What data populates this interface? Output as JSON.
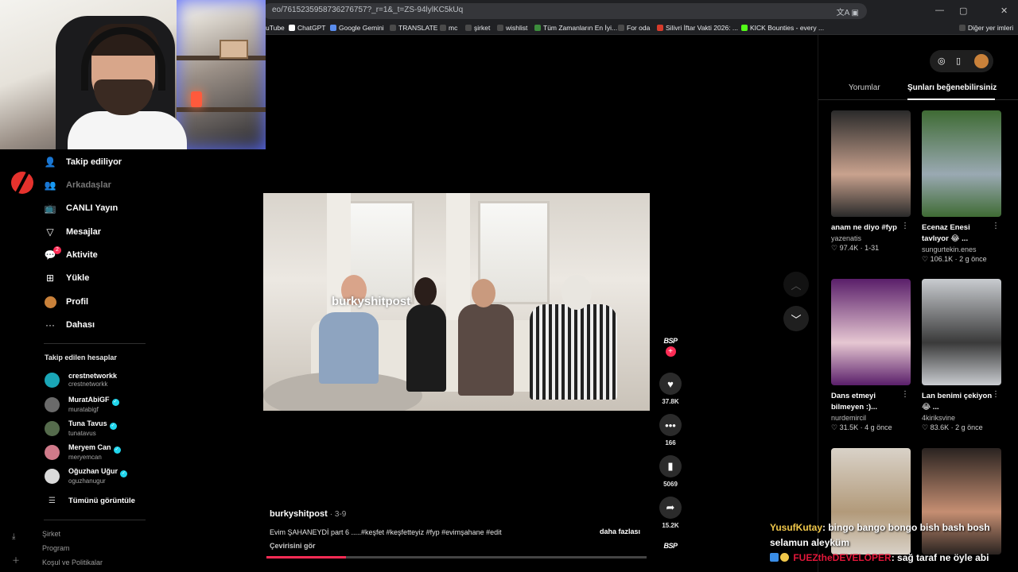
{
  "browser": {
    "url": "eo/7615235958736276757?_r=1&_t=ZS-94lylKC5kUq",
    "bookmarks": [
      "uTube",
      "ChatGPT",
      "Google Gemini",
      "TRANSLATE",
      "mc",
      "şirket",
      "wishlist",
      "Tüm Zamanların En İyi...",
      "For oda",
      "Silivri İftar Vakti 2026: ...",
      "KICK Bounties - every ...",
      "Diğer yer imleri"
    ],
    "window_controls": [
      "—",
      "▢",
      "✕"
    ]
  },
  "sidebar": {
    "nav": [
      {
        "label": "Takip ediliyor",
        "icon": "following-icon"
      },
      {
        "label": "Arkadaşlar",
        "icon": "friends-icon"
      },
      {
        "label": "CANLI Yayın",
        "icon": "live-icon"
      },
      {
        "label": "Mesajlar",
        "icon": "messages-icon"
      },
      {
        "label": "Aktivite",
        "icon": "activity-icon",
        "badge": "2"
      },
      {
        "label": "Yükle",
        "icon": "upload-icon"
      },
      {
        "label": "Profil",
        "icon": "profile-icon"
      },
      {
        "label": "Dahası",
        "icon": "more-icon"
      }
    ],
    "following_title": "Takip edilen hesaplar",
    "accounts": [
      {
        "name": "crestnetworkk",
        "handle": "crestnetworkk",
        "verified": false,
        "color": "#1aa6b7"
      },
      {
        "name": "MuratAbiGF",
        "handle": "muratabigf",
        "verified": true,
        "color": "#6a6a6a"
      },
      {
        "name": "Tuna Tavus",
        "handle": "tunatavus",
        "verified": true,
        "color": "#556b4c"
      },
      {
        "name": "Meryem Can",
        "handle": "meryemcan",
        "verified": true,
        "color": "#d07a8a"
      },
      {
        "name": "Oğuzhan Uğur",
        "handle": "oguzhanugur",
        "verified": true,
        "color": "#dadada"
      }
    ],
    "see_all": "Tümünü görüntüle",
    "footer": [
      "Şirket",
      "Program",
      "Koşul ve Politikalar"
    ]
  },
  "video": {
    "watermark": "burkyshitpost",
    "author": "burkyshitpost",
    "date": "3-9",
    "description": "Evim ŞAHANEYDİ part 6 .....#keşfet #keşfetteyiz #fyp #evimşahane #edit",
    "more": "daha fazlası",
    "translate": "Çevirisini gör",
    "progress": 0.21
  },
  "actions": {
    "brand": "BSP",
    "likes": "37.8K",
    "comments": "166",
    "saves": "5069",
    "shares": "15.2K"
  },
  "panel": {
    "tabs": [
      "Yorumlar",
      "Şunları beğenebilirsiniz"
    ],
    "active_tab": 1,
    "cards": [
      {
        "title": "anam ne diyo #fyp",
        "author": "yazenatis",
        "likes": "97.4K",
        "when": "1-31",
        "thumb": [
          "#2a2a2a",
          "#c9a28e"
        ]
      },
      {
        "title": "Ecenaz Enesi tavlıyor 😂 ...",
        "author": "sungurtekin.enes",
        "likes": "106.1K",
        "when": "2 g önce",
        "thumb": [
          "#3f6b34",
          "#9aa9b2"
        ]
      },
      {
        "title": "Dans etmeyi bilmeyen :)...",
        "author": "nurdemircil",
        "likes": "31.5K",
        "when": "4 g önce",
        "thumb": [
          "#5a1f6a",
          "#e6c7d2"
        ]
      },
      {
        "title": "Lan benimi çekiyon 😂 ...",
        "author": "4kiriksvine",
        "likes": "83.6K",
        "when": "2 g önce",
        "thumb": [
          "#c9ccd0",
          "#3a3a3a"
        ]
      },
      {
        "title": "",
        "author": "",
        "likes": "",
        "when": "",
        "thumb": [
          "#d9d2c8",
          "#b29a7a"
        ]
      },
      {
        "title": "",
        "author": "",
        "likes": "",
        "when": "",
        "thumb": [
          "#2a2320",
          "#c58e72"
        ]
      }
    ]
  },
  "chat": [
    {
      "user": "YusufKutay",
      "message": ": bingo bango bongo bish bash bosh selamun aleyküm"
    },
    {
      "user": "FUEZtheDEVELOPER",
      "message": ": sağ taraf ne öyle abi"
    }
  ]
}
